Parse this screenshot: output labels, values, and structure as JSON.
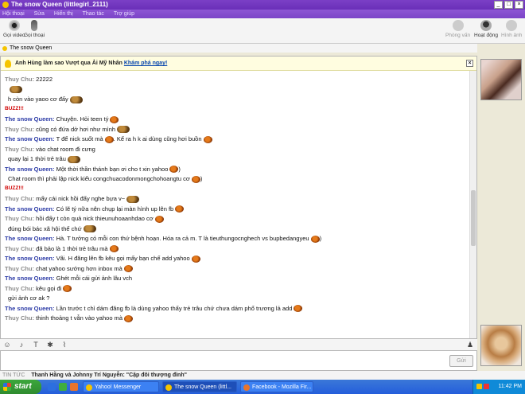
{
  "window": {
    "title": "The snow Queen (littlegirl_2111)"
  },
  "menu": [
    "Hội thoại",
    "Sửa",
    "Hiển thị",
    "Thao tác",
    "Trợ giúp"
  ],
  "toolbar": {
    "left": [
      {
        "label": "Gọi video",
        "icon": "webcam-icon"
      },
      {
        "label": "Gọi thoại",
        "icon": "microphone-icon"
      }
    ],
    "right": [
      {
        "label": "Phòng vấn",
        "icon": "interview-icon"
      },
      {
        "label": "Hoạt động",
        "icon": "activity-icon"
      },
      {
        "label": "Hình ảnh",
        "icon": "image-icon"
      }
    ]
  },
  "contact_status": "The snow Queen",
  "notice": {
    "text": "Anh Hùng làm sao Vượt qua Ải Mỹ Nhân",
    "link": "Khám phá ngay!"
  },
  "messages": [
    {
      "sender": "Thuy Chu",
      "text": "22222",
      "emo": ""
    },
    {
      "sender": "",
      "text": "",
      "emo": "pair"
    },
    {
      "sender": "",
      "text": "h còn vào yaoo cơ đấy",
      "emo": "pair"
    },
    {
      "buzz": "BUZZ!!!"
    },
    {
      "sender": "The snow Queen",
      "text": "Chuyện. Hỏi teen tý",
      "emo": "red"
    },
    {
      "sender": "Thuy Chu",
      "text": "cũng có đứa dở hơi như mình",
      "emo": "pair"
    },
    {
      "sender": "The snow Queen",
      "text": "T để nick suốt mà",
      "emo": "red",
      "after": ". Kể ra h k ai dùng cũng hơi buồn",
      "emo2": "red"
    },
    {
      "sender": "Thuy Chu",
      "text": "vào chat room đi cưng",
      "emo": ""
    },
    {
      "sender": "",
      "text": "quay lại 1 thời trẻ trâu",
      "emo": "pair"
    },
    {
      "sender": "The snow Queen",
      "text": "Một thời thần thánh bạn ơi cho t xin yahoo",
      "emo": "red",
      "after": ")",
      "emo2": ""
    },
    {
      "sender": "",
      "text": "Chat room thì phải lập nick kiểu congchuacodonmongchohoangtu cơ",
      "emo": "red",
      "after": ")",
      "emo2": ""
    },
    {
      "buzz": "BUZZ!!!"
    },
    {
      "sender": "Thuy Chu",
      "text": "mấy cái nick hồi đấy nghe bựa v~",
      "emo": "pair"
    },
    {
      "sender": "The snow Queen",
      "text": "Có lẽ tý nữa nên chụp lại màn hình up lên fb",
      "emo": "red"
    },
    {
      "sender": "Thuy Chu",
      "text": "hồi đấy t còn quả nick thieunuhoaanhdao cơ",
      "emo": "red"
    },
    {
      "sender": "",
      "text": "đúng bói bác xã hội thế chứ",
      "emo": "pair"
    },
    {
      "sender": "The snow Queen",
      "text": "Hà. T tưởng có mỗi con thứ bệnh hoạn. Hóa ra cả m. T là tieuthungocnghech vs bupbedangyeu",
      "emo": "red",
      "after": ")",
      "emo2": ""
    },
    {
      "sender": "Thuy Chu",
      "text": "đã bảo là 1 thời trẻ trâu mà",
      "emo": "red"
    },
    {
      "sender": "The snow Queen",
      "text": "Vãi. H đăng lên fb kêu gọi mấy bạn chế add yahoo",
      "emo": "red"
    },
    {
      "sender": "Thuy Chu",
      "text": "chat yahoo sướng hơn inbox mà",
      "emo": "red"
    },
    {
      "sender": "The snow Queen",
      "text": "Ghét mỗi cái gửi ảnh lâu vch",
      "emo": ""
    },
    {
      "sender": "Thuy Chu",
      "text": "kêu gọi đi",
      "emo": "red"
    },
    {
      "sender": "",
      "text": "gửi ảnh cơ ak ?",
      "emo": ""
    },
    {
      "sender": "The snow Queen",
      "text": "Lần trước t chỉ dám đăng fb là dùng yahoo thấy trẻ trâu chứ chưa dám phổ trương lả add",
      "emo": "red"
    },
    {
      "sender": "Thuy Chu",
      "text": "thinh thoảng t vẫn vào yahoo mà",
      "emo": "red"
    }
  ],
  "compose": {
    "send_label": "Gửi"
  },
  "news": {
    "label": "TIN TỨC",
    "text": "Thanh Hằng và Johnny Trí Nguyễn: \"Cặp đôi thượng đỉnh\""
  },
  "taskbar": {
    "start": "start",
    "tasks": [
      "Yahoo! Messenger",
      "The snow Queen (littl...",
      "Facebook - Mozilla Fir..."
    ],
    "time": "11:42 PM"
  }
}
